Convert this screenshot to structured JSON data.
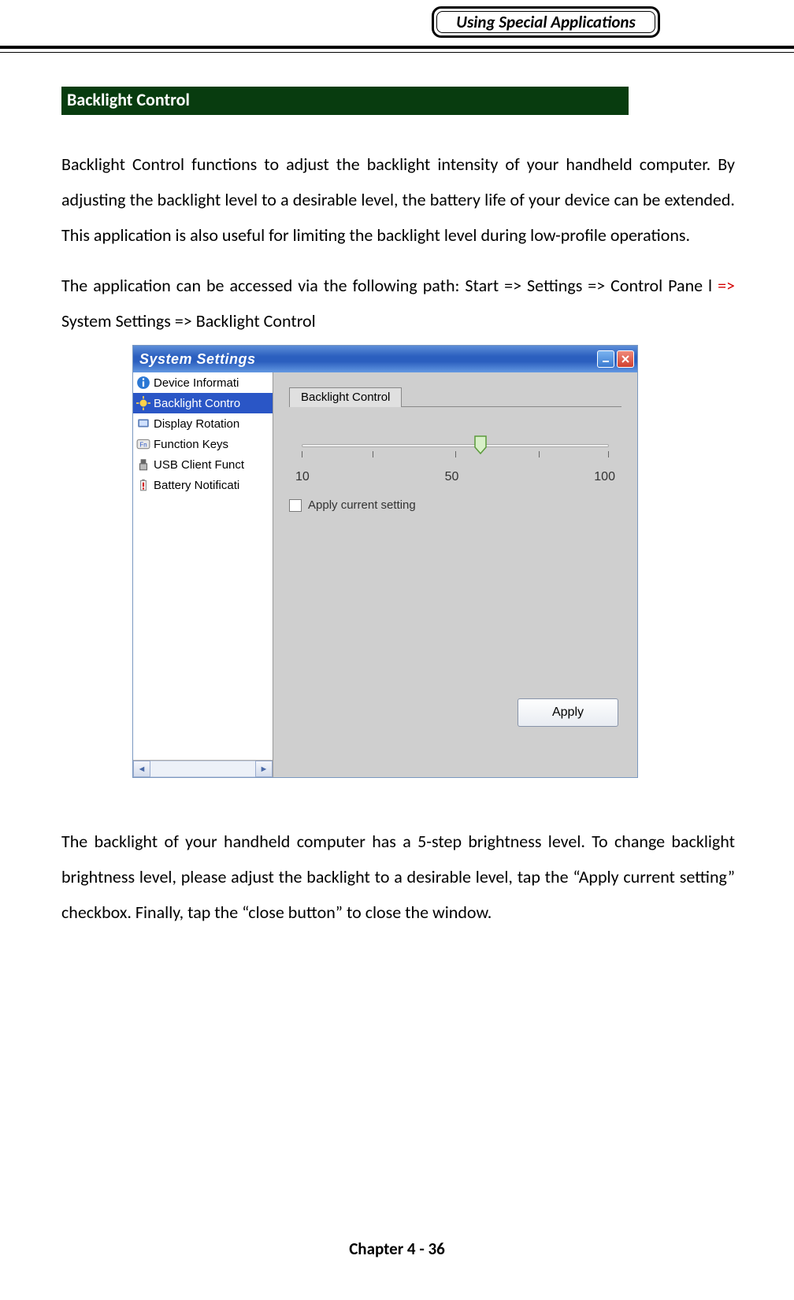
{
  "header": {
    "badge": "Using Special Applications"
  },
  "section_title": "Backlight Control",
  "para1": "Backlight Control functions to adjust the backlight intensity of your handheld computer. By adjusting the backlight level to a desirable level, the battery life of your device can be extended. This application is also useful for limiting the backlight level during low-profile operations.",
  "para2_prefix": "The application can be accessed via the following path: Start => Settings => Control Pane l ",
  "para2_red": "=>",
  "para2_suffix": " System Settings => Backlight Control",
  "window": {
    "title": "System Settings",
    "sidebar": {
      "items": [
        {
          "label": "Device Informati"
        },
        {
          "label": "Backlight Contro"
        },
        {
          "label": "Display Rotation"
        },
        {
          "label": "Function Keys"
        },
        {
          "label": "USB Client Funct"
        },
        {
          "label": "Battery Notificati"
        }
      ],
      "selected_index": 1
    },
    "panel": {
      "tab": "Backlight Control",
      "slider": {
        "min": 10,
        "mid": 50,
        "max": 100
      },
      "checkbox_label": "Apply current setting",
      "apply_label": "Apply"
    }
  },
  "para3": "The backlight of your handheld computer has a 5-step brightness level. To change backlight brightness level, please adjust the backlight to a desirable level, tap the “Apply current setting” checkbox. Finally, tap the “close button” to close the window.",
  "footer": "Chapter 4 - 36"
}
